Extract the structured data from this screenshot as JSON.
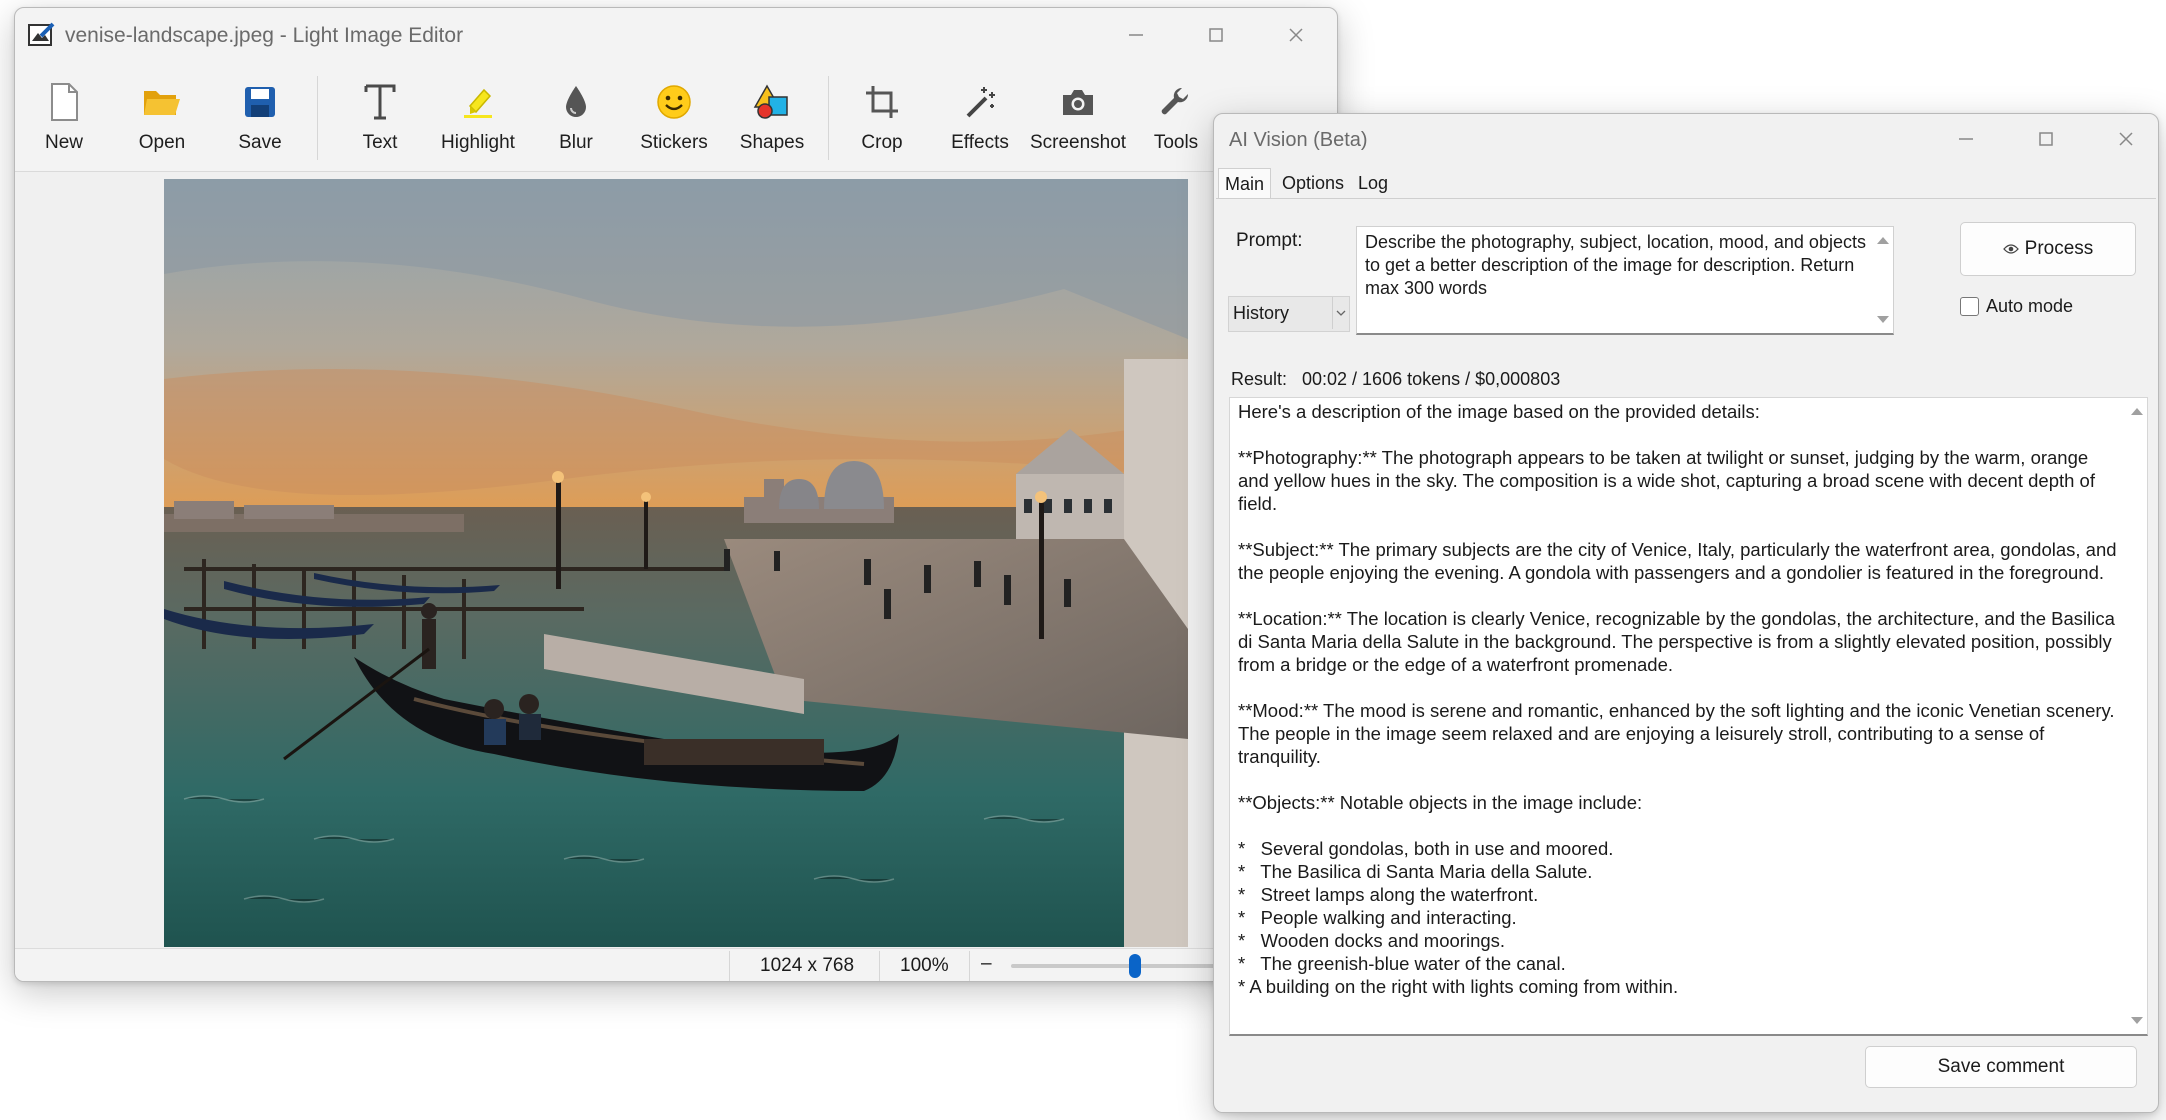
{
  "editor": {
    "title": "venise-landscape.jpeg - Light Image Editor",
    "toolbar": [
      {
        "label": "New",
        "icon": "new-file-icon"
      },
      {
        "label": "Open",
        "icon": "open-folder-icon"
      },
      {
        "label": "Save",
        "icon": "save-disk-icon"
      },
      {
        "label": "Text",
        "icon": "text-icon"
      },
      {
        "label": "Highlight",
        "icon": "highlighter-icon"
      },
      {
        "label": "Blur",
        "icon": "blur-drop-icon"
      },
      {
        "label": "Stickers",
        "icon": "smiley-sticker-icon"
      },
      {
        "label": "Shapes",
        "icon": "shapes-icon"
      },
      {
        "label": "Crop",
        "icon": "crop-icon"
      },
      {
        "label": "Effects",
        "icon": "magic-wand-icon"
      },
      {
        "label": "Screenshot",
        "icon": "camera-icon"
      },
      {
        "label": "Tools",
        "icon": "wrench-icon"
      }
    ],
    "status": {
      "dimensions": "1024 x 768",
      "zoom": "100%",
      "zoom_minus": "–",
      "zoom_slider_fraction": 0.5
    }
  },
  "ai": {
    "title": "AI Vision (Beta)",
    "tabs": [
      "Main",
      "Options",
      "Log"
    ],
    "prompt_label": "Prompt:",
    "history_label": "History",
    "prompt_text": "Describe the photography, subject, location, mood, and objects to get a better description of the image for description. Return max 300 words",
    "process_label": "Process",
    "auto_mode_label": "Auto mode",
    "result_label": "Result:",
    "result_meta": "00:02 / 1606 tokens / $0,000803",
    "result_text": "Here's a description of the image based on the provided details:\n\n**Photography:** The photograph appears to be taken at twilight or sunset, judging by the warm, orange and yellow hues in the sky. The composition is a wide shot, capturing a broad scene with decent depth of field.\n\n**Subject:** The primary subjects are the city of Venice, Italy, particularly the waterfront area, gondolas, and the people enjoying the evening. A gondola with passengers and a gondolier is featured in the foreground.\n\n**Location:** The location is clearly Venice, recognizable by the gondolas, the architecture, and the Basilica di Santa Maria della Salute in the background. The perspective is from a slightly elevated position, possibly from a bridge or the edge of a waterfront promenade.\n\n**Mood:** The mood is serene and romantic, enhanced by the soft lighting and the iconic Venetian scenery. The people in the image seem relaxed and are enjoying a leisurely stroll, contributing to a sense of tranquility.\n\n**Objects:** Notable objects in the image include:\n\n*   Several gondolas, both in use and moored.\n*   The Basilica di Santa Maria della Salute.\n*   Street lamps along the waterfront.\n*   People walking and interacting.\n*   Wooden docks and moorings.\n*   The greenish-blue water of the canal.\n* A building on the right with lights coming from within.",
    "save_comment_label": "Save comment"
  },
  "colors": {
    "accent": "#0a64c8",
    "folder": "#f2b61e",
    "save_disk": "#1f5fae",
    "highlight": "#f3e21b",
    "sticker": "#ffcc1a"
  }
}
